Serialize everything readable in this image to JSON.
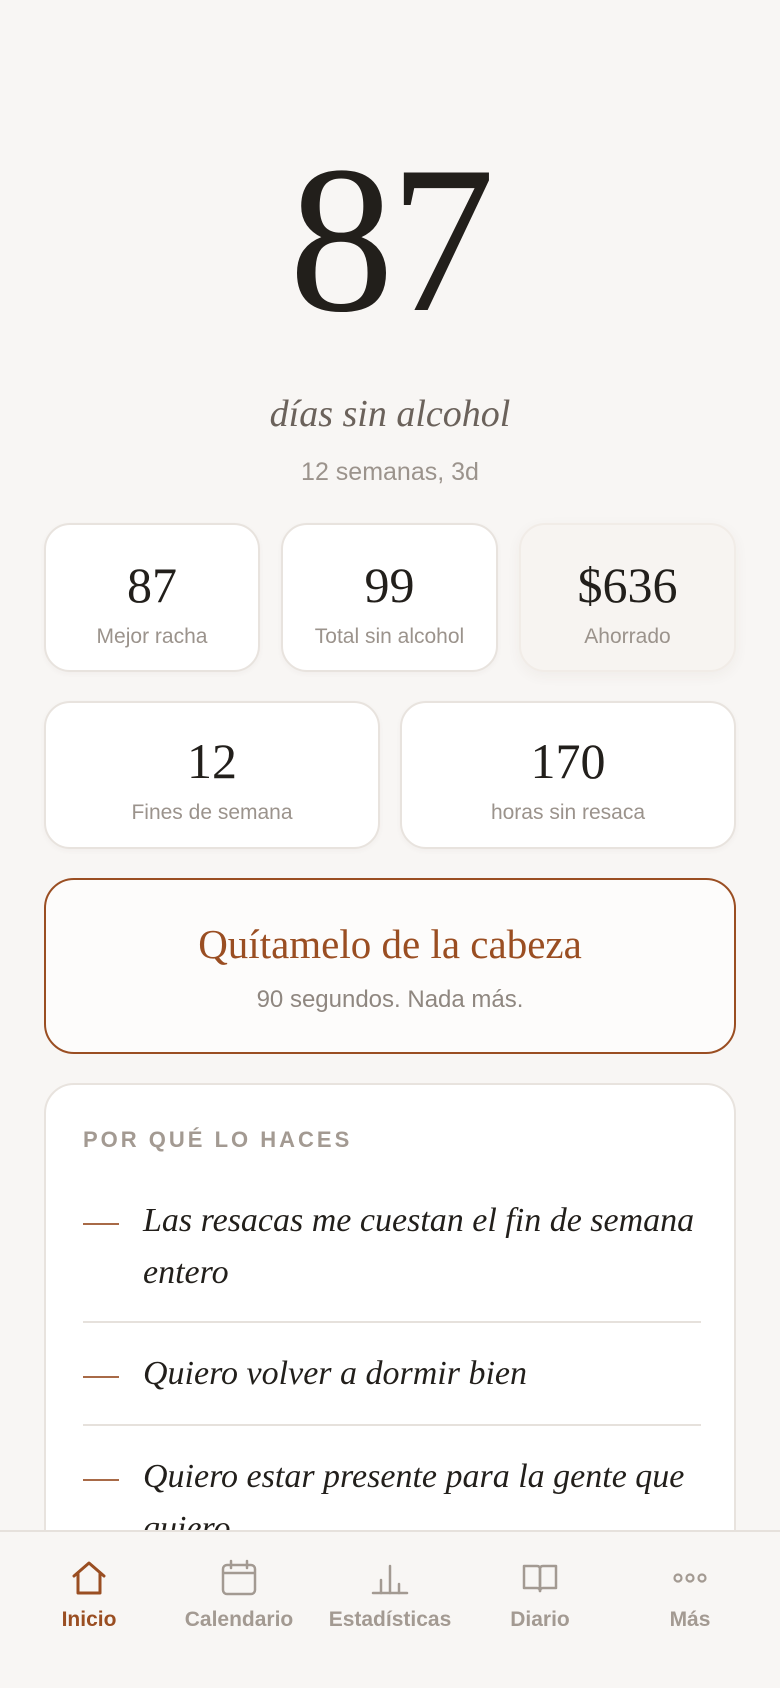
{
  "hero": {
    "days": "87",
    "label": "días sin alcohol",
    "sub": "12 semanas, 3d"
  },
  "stats": [
    {
      "value": "87",
      "label": "Mejor racha"
    },
    {
      "value": "99",
      "label": "Total sin alcohol"
    },
    {
      "value": "$636",
      "label": "Ahorrado"
    },
    {
      "value": "12",
      "label": "Fines de semana"
    },
    {
      "value": "170",
      "label": "horas sin resaca"
    }
  ],
  "cta": {
    "title": "Quítamelo de la cabeza",
    "sub": "90 segundos. Nada más."
  },
  "reasons": {
    "title": "POR QUÉ LO HACES",
    "items": [
      "Las resacas me cuestan el fin de semana entero",
      "Quiero volver a dormir bien",
      "Quiero estar presente para la gente que quiero"
    ]
  },
  "tabs": [
    {
      "label": "Inicio",
      "icon": "home-icon"
    },
    {
      "label": "Calendario",
      "icon": "calendar-icon"
    },
    {
      "label": "Estadísticas",
      "icon": "chart-icon"
    },
    {
      "label": "Diario",
      "icon": "book-icon"
    },
    {
      "label": "Más",
      "icon": "more-icon"
    }
  ],
  "colors": {
    "accent": "#9a4e22",
    "background": "#f8f6f4",
    "muted_text": "#9b938c"
  }
}
